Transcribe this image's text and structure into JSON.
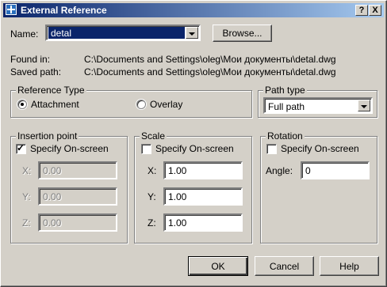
{
  "window": {
    "title": "External Reference",
    "help_btn": "?",
    "close_btn": "X"
  },
  "name": {
    "label": "Name:",
    "value": "detal",
    "browse_label": "Browse..."
  },
  "info": {
    "found_in_label": "Found in:",
    "found_in_value": "C:\\Documents and Settings\\oleg\\Мои документы\\detal.dwg",
    "saved_path_label": "Saved path:",
    "saved_path_value": "C:\\Documents and Settings\\oleg\\Мои документы\\detal.dwg"
  },
  "reference_type": {
    "title": "Reference Type",
    "options": [
      {
        "label": "Attachment",
        "selected": true
      },
      {
        "label": "Overlay",
        "selected": false
      }
    ]
  },
  "path_type": {
    "title": "Path type",
    "value": "Full path"
  },
  "insertion_point": {
    "title": "Insertion point",
    "specify_label": "Specify On-screen",
    "specify_checked": true,
    "x_label": "X:",
    "x_value": "0.00",
    "y_label": "Y:",
    "y_value": "0.00",
    "z_label": "Z:",
    "z_value": "0.00"
  },
  "scale": {
    "title": "Scale",
    "specify_label": "Specify On-screen",
    "specify_checked": false,
    "x_label": "X:",
    "x_value": "1.00",
    "y_label": "Y:",
    "y_value": "1.00",
    "z_label": "Z:",
    "z_value": "1.00"
  },
  "rotation": {
    "title": "Rotation",
    "specify_label": "Specify On-screen",
    "specify_checked": false,
    "angle_label": "Angle:",
    "angle_value": "0"
  },
  "buttons": {
    "ok": "OK",
    "cancel": "Cancel",
    "help": "Help"
  },
  "colors": {
    "title_start": "#0a246a",
    "title_end": "#a6caf0",
    "face": "#d4d0c8",
    "selection": "#0a246a"
  }
}
